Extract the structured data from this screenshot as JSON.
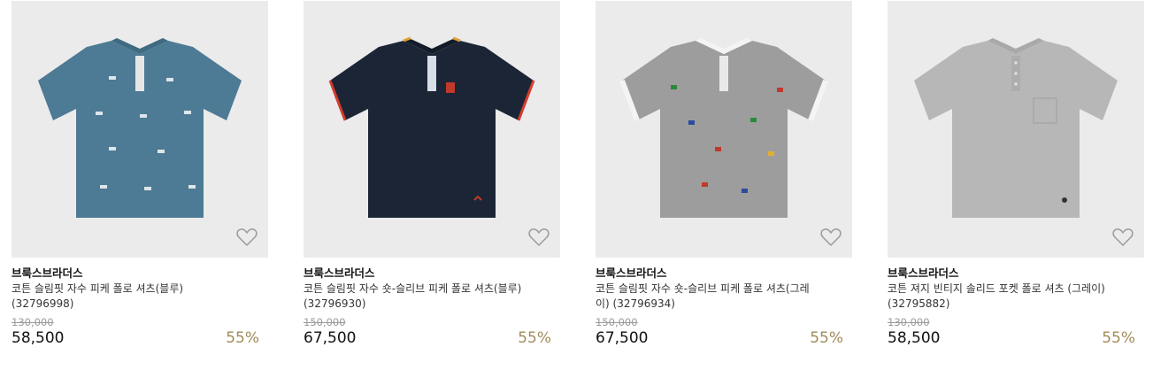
{
  "colors": {
    "discount": "#a08c5b",
    "thumb_bg": "#ebebeb"
  },
  "products": [
    {
      "brand": "브룩스브라더스",
      "name": "코튼 슬림핏 자수 피케 폴로 셔츠(블루) (32796998)",
      "original_price": "130,000",
      "price": "58,500",
      "discount": "55%",
      "icon": "heart-outline-icon",
      "shirt_color": "#4d7a94"
    },
    {
      "brand": "브룩스브라더스",
      "name": "코튼 슬림핏 자수 숏-슬리브 피케 폴로 셔츠(블루) (32796930)",
      "original_price": "150,000",
      "price": "67,500",
      "discount": "55%",
      "icon": "heart-outline-icon",
      "shirt_color": "#1b2535"
    },
    {
      "brand": "브룩스브라더스",
      "name": "코튼 슬림핏 자수 숏-슬리브 피케 폴로 셔츠(그레이) (32796934)",
      "original_price": "150,000",
      "price": "67,500",
      "discount": "55%",
      "icon": "heart-outline-icon",
      "shirt_color": "#9d9d9d"
    },
    {
      "brand": "브룩스브라더스",
      "name": "코튼 져지 빈티지 솔리드 포켓 폴로 셔츠 (그레이) (32795882)",
      "original_price": "130,000",
      "price": "58,500",
      "discount": "55%",
      "icon": "heart-outline-icon",
      "shirt_color": "#b7b7b7"
    }
  ]
}
